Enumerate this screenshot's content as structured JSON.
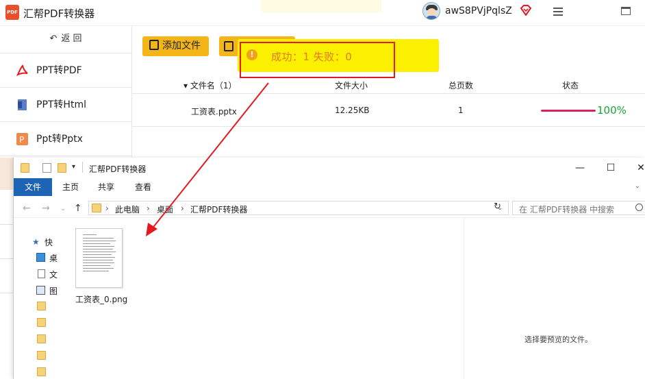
{
  "app": {
    "logo_text": "PDF",
    "title": "汇帮PDF转换器",
    "username": "awS8PVjPqlsZ"
  },
  "sidebar": {
    "back_label": "返 回",
    "items": [
      {
        "label": "PPT转PDF"
      },
      {
        "label": "PPT转Html"
      },
      {
        "label": "Ppt转Pptx"
      }
    ]
  },
  "toolbar": {
    "add_file_label": "添加文件"
  },
  "toast": {
    "icon": "!",
    "text": "成功：1   失败：0"
  },
  "table": {
    "headers": [
      "▾ 文件名（1）",
      "文件大小",
      "总页数",
      "状态"
    ],
    "rows": [
      {
        "name": "工资表.pptx",
        "size": "12.25KB",
        "pages": "1",
        "progress": "100%"
      }
    ]
  },
  "explorer": {
    "title": "汇帮PDF转换器",
    "tabs": [
      "文件",
      "主页",
      "共享",
      "查看"
    ],
    "path": [
      "此电脑",
      "桌面",
      "汇帮PDF转换器"
    ],
    "search_placeholder": "在 汇帮PDF转换器 中搜索",
    "nav_items": [
      "快",
      "桌",
      "文",
      "图"
    ],
    "file_name": "工资表_0.png",
    "preview_text": "选择要预览的文件。"
  },
  "colors": {
    "accent_yellow": "#f4b518",
    "toast_yellow": "#fbf000",
    "highlight_red": "#e3191e",
    "progress_pink": "#d8245f",
    "success_green": "#1aa33b",
    "ribbon_blue": "#1e64b4"
  }
}
